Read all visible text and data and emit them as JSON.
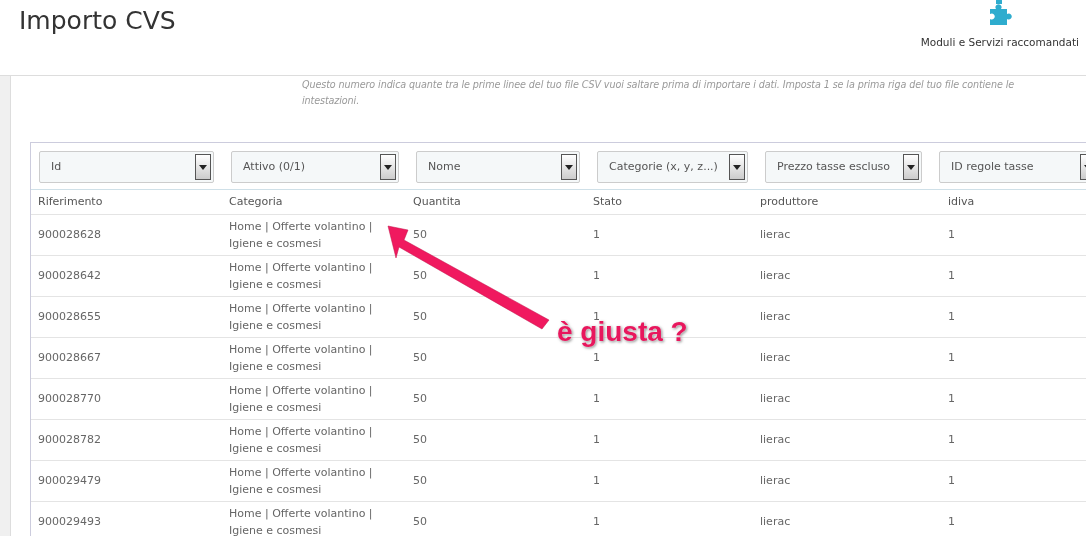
{
  "header": {
    "title": "Importo CVS",
    "toolbar_button": "Moduli e Servizi raccomandati"
  },
  "help_text": "Questo numero indica quante tra le prime linee del tuo file CSV vuoi saltare prima di importare i dati. Imposta 1 se la prima riga del tuo file contiene le intestazioni.",
  "mapping_selects": [
    "Id",
    "Attivo (0/1)",
    "Nome",
    "Categorie (x, y, z...)",
    "Prezzo tasse escluso",
    "ID regole tasse"
  ],
  "table": {
    "columns": [
      "Riferimento",
      "Categoria",
      "Quantita",
      "Stato",
      "produttore",
      "idiva"
    ],
    "rows": [
      [
        "900028628",
        "Home | Offerte volantino | Igiene e cosmesi",
        "50",
        "1",
        "lierac",
        "1"
      ],
      [
        "900028642",
        "Home | Offerte volantino | Igiene e cosmesi",
        "50",
        "1",
        "lierac",
        "1"
      ],
      [
        "900028655",
        "Home | Offerte volantino | Igiene e cosmesi",
        "50",
        "1",
        "lierac",
        "1"
      ],
      [
        "900028667",
        "Home | Offerte volantino | Igiene e cosmesi",
        "50",
        "1",
        "lierac",
        "1"
      ],
      [
        "900028770",
        "Home | Offerte volantino | Igiene e cosmesi",
        "50",
        "1",
        "lierac",
        "1"
      ],
      [
        "900028782",
        "Home | Offerte volantino | Igiene e cosmesi",
        "50",
        "1",
        "lierac",
        "1"
      ],
      [
        "900029479",
        "Home | Offerte volantino | Igiene e cosmesi",
        "50",
        "1",
        "lierac",
        "1"
      ],
      [
        "900029493",
        "Home | Offerte volantino | Igiene e cosmesi",
        "50",
        "1",
        "lierac",
        "1"
      ]
    ]
  },
  "annotation": {
    "text": "è giusta ?"
  }
}
